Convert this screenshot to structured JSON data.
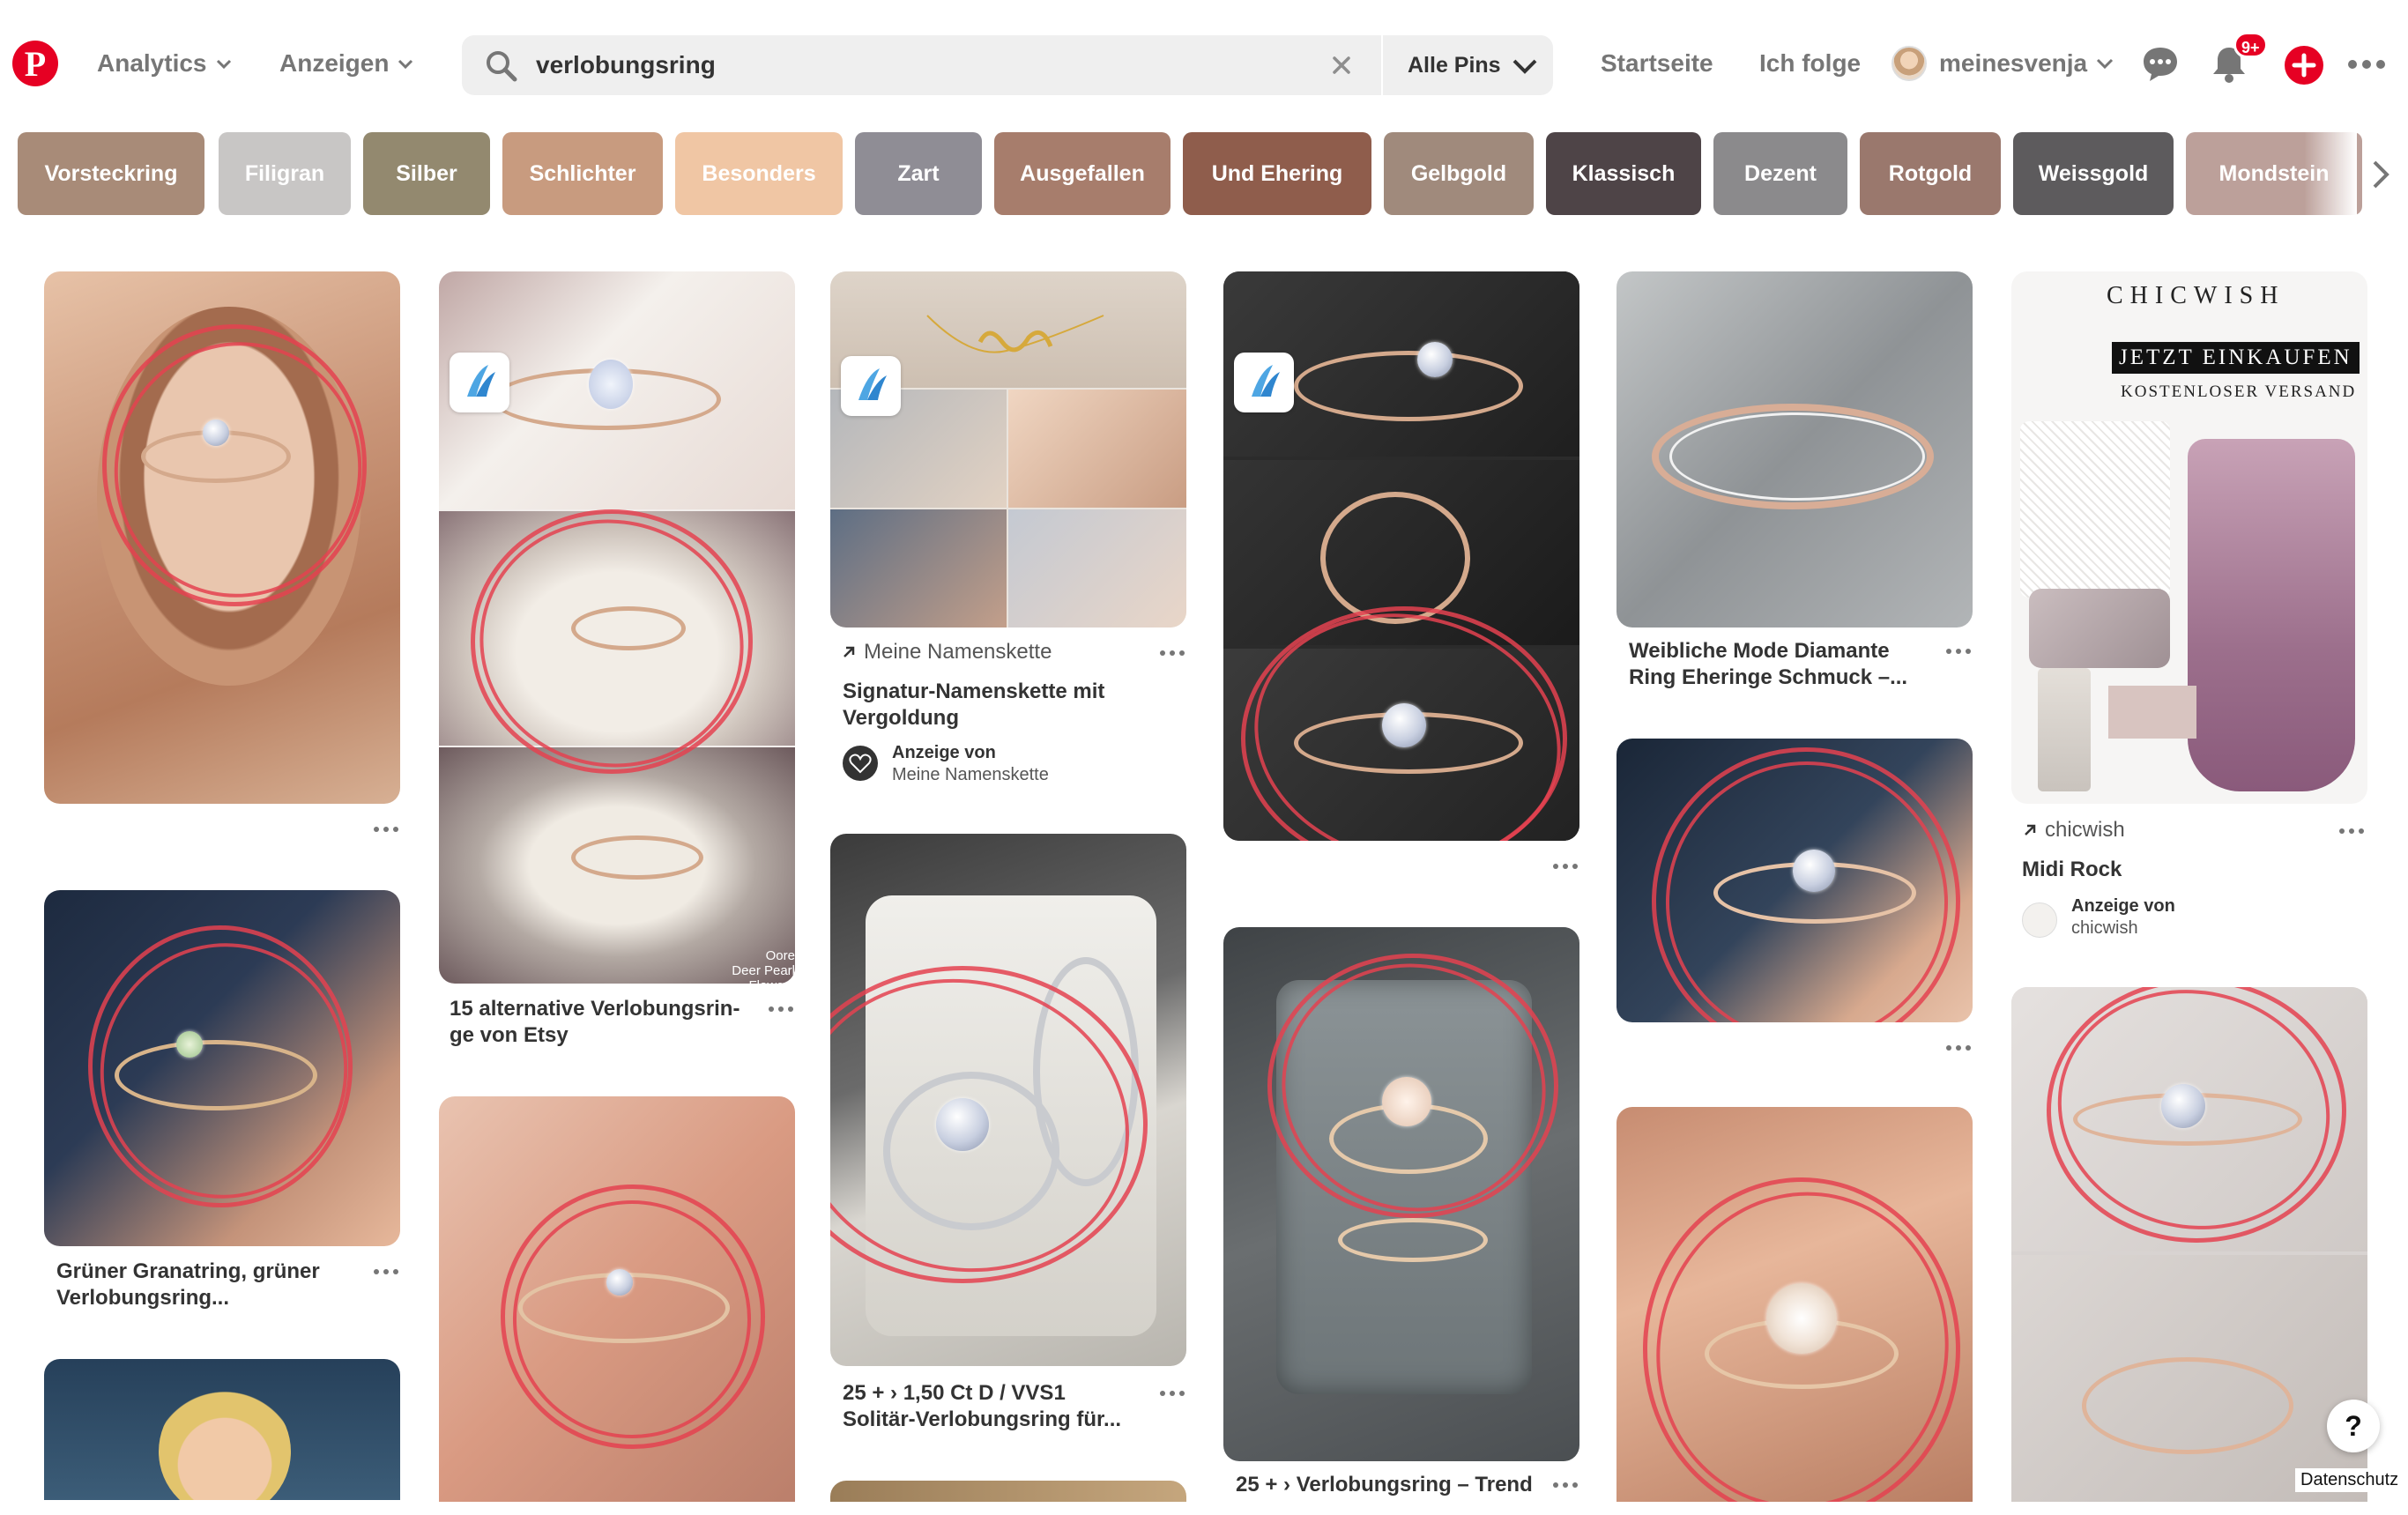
{
  "header": {
    "analytics_label": "Analytics",
    "ads_label": "Anzeigen",
    "search_query": "verlobungsring",
    "search_scope": "Alle Pins",
    "home_label": "Startseite",
    "following_label": "Ich folge",
    "username": "meinesvenja",
    "notification_badge": "9+"
  },
  "chips": [
    {
      "label": "Vorsteckring",
      "color": "#a88b78"
    },
    {
      "label": "Filigran",
      "color": "#c8c6c5"
    },
    {
      "label": "Silber",
      "color": "#93896f"
    },
    {
      "label": "Schlichter",
      "color": "#c89b7f"
    },
    {
      "label": "Besonders",
      "color": "#f0c6a4"
    },
    {
      "label": "Zart",
      "color": "#8f8d95"
    },
    {
      "label": "Ausgefallen",
      "color": "#a77d6c"
    },
    {
      "label": "Und Ehering",
      "color": "#8f5d4c"
    },
    {
      "label": "Gelbgold",
      "color": "#a08a7c"
    },
    {
      "label": "Klassisch",
      "color": "#4e4447"
    },
    {
      "label": "Dezent",
      "color": "#8b8a8c"
    },
    {
      "label": "Rotgold",
      "color": "#9a786d"
    },
    {
      "label": "Weissgold",
      "color": "#5d5b5d"
    },
    {
      "label": "Mondstein",
      "color": "#bca09a"
    }
  ],
  "pins": {
    "col2_title": "15 alternative Verlobungsrin-ge von Etsy",
    "col2_watermark_1": "Oore",
    "col2_watermark_2": "Deer Pearl Flowers",
    "col3_source": "Meine Namenskette",
    "col3_title": "Signatur-Namenskette mit Vergoldung",
    "col3_ad_label": "Anzeige von",
    "col3_ad_name": "Meine Namenskette",
    "col3_title2": "25 + › 1,50 Ct D / VVS1 Solitär-Verlobungsring für...",
    "col1_title": "Grüner Granatring, grüner Verlobungsring...",
    "col4_title": "25 + › Verlobungsring – Trend",
    "col5_title": "Weibliche Mode Diamante Ring Eheringe Schmuck –...",
    "col6_brand": "CHICWISH",
    "col6_cta": "JETZT EINKAUFEN",
    "col6_ship": "KOSTENLOSER VERSAND",
    "col6_source": "chicwish",
    "col6_title": "Midi Rock",
    "col6_ad_label": "Anzeige von",
    "col6_ad_name": "chicwish"
  },
  "footer": {
    "help_label": "?",
    "privacy_label": "Datenschutz"
  },
  "colors": {
    "brand_red": "#e60023",
    "annotation_red": "#e44250"
  }
}
